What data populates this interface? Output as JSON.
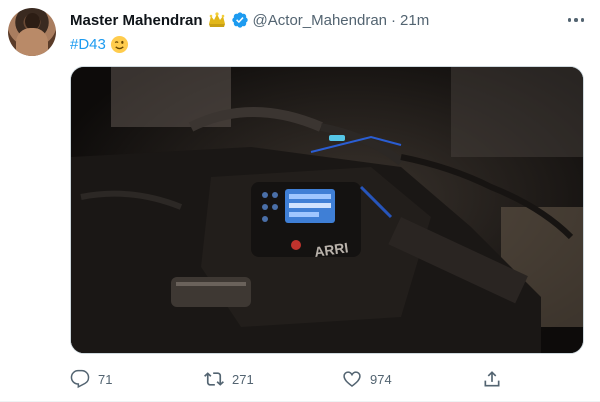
{
  "tweet": {
    "display_name": "Master Mahendran",
    "handle": "@Actor_Mahendran",
    "separator": "·",
    "time": "21m",
    "text_hashtag": "#D43",
    "emoji": "wink-emoji",
    "media_alt_icon": "camera-photo",
    "media_text": "ARRI",
    "actions": {
      "reply_count": "71",
      "retweet_count": "271",
      "like_count": "974"
    }
  },
  "colors": {
    "accent": "#1d9bf0",
    "muted": "#536471",
    "text": "#0f1419",
    "badge_gold": "#e2b719"
  }
}
